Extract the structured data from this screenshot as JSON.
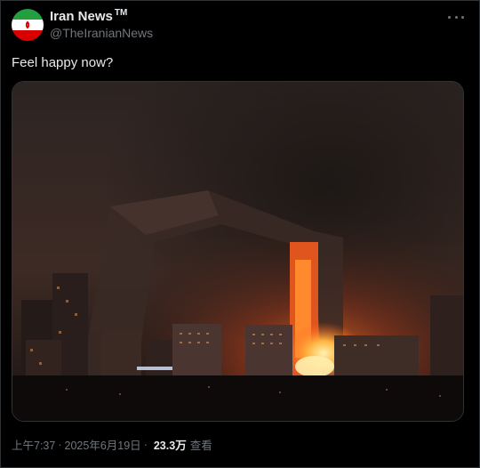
{
  "author": {
    "display_name": "Iran News",
    "tm_mark": "TM",
    "handle": "@TheIranianNews"
  },
  "tweet": {
    "text": "Feel happy now?"
  },
  "meta": {
    "time": "上午7:37",
    "separator": "·",
    "date": "2025年6月19日",
    "views": "23.3万",
    "views_label": "查看"
  },
  "colors": {
    "background": "#000000",
    "primary_text": "#e7e9ea",
    "secondary_text": "#71767b",
    "border": "#2f3336"
  },
  "icons": {
    "more": "more-horizontal-icon",
    "avatar": "iran-flag-avatar"
  }
}
